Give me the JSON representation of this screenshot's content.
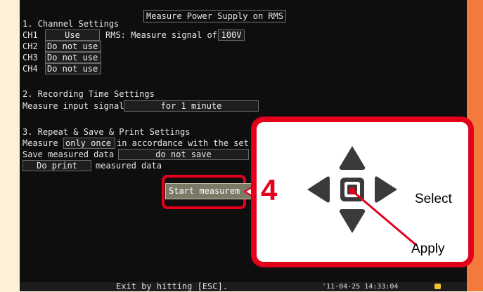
{
  "screen": {
    "title": "Measure Power Supply on RMS",
    "section1": "1. Channel Settings",
    "ch1_label": "CH1",
    "ch1_value": "Use",
    "rms_label": "RMS: Measure signal of",
    "rms_value": "100V",
    "ch2_label": "CH2",
    "ch2_value": "Do not use",
    "ch3_label": "CH3",
    "ch3_value": "Do not use",
    "ch4_label": "CH4",
    "ch4_value": "Do not use",
    "section2": "2. Recording Time Settings",
    "input_label": "Measure input signal",
    "input_value": "for 1 minute",
    "section3": "3. Repeat & Save & Print Settings",
    "measure_label": "Measure",
    "measure_value": "only once",
    "measure_suffix": "in accordance with the set v",
    "save_label": "Save measured data",
    "save_value": "do not save",
    "print_value": "Do print",
    "print_suffix": "measured data",
    "start_button": "Start measurem",
    "status_exit": "Exit by hitting [ESC].",
    "status_time": "'11-04-25 14:33:04"
  },
  "callout": {
    "step_number": "4",
    "select_label": "Select",
    "apply_label": "Apply"
  },
  "colors": {
    "accent_red": "#e3001b",
    "side_orange": "#f47a3c",
    "screen_bg": "#0e0e0e"
  }
}
